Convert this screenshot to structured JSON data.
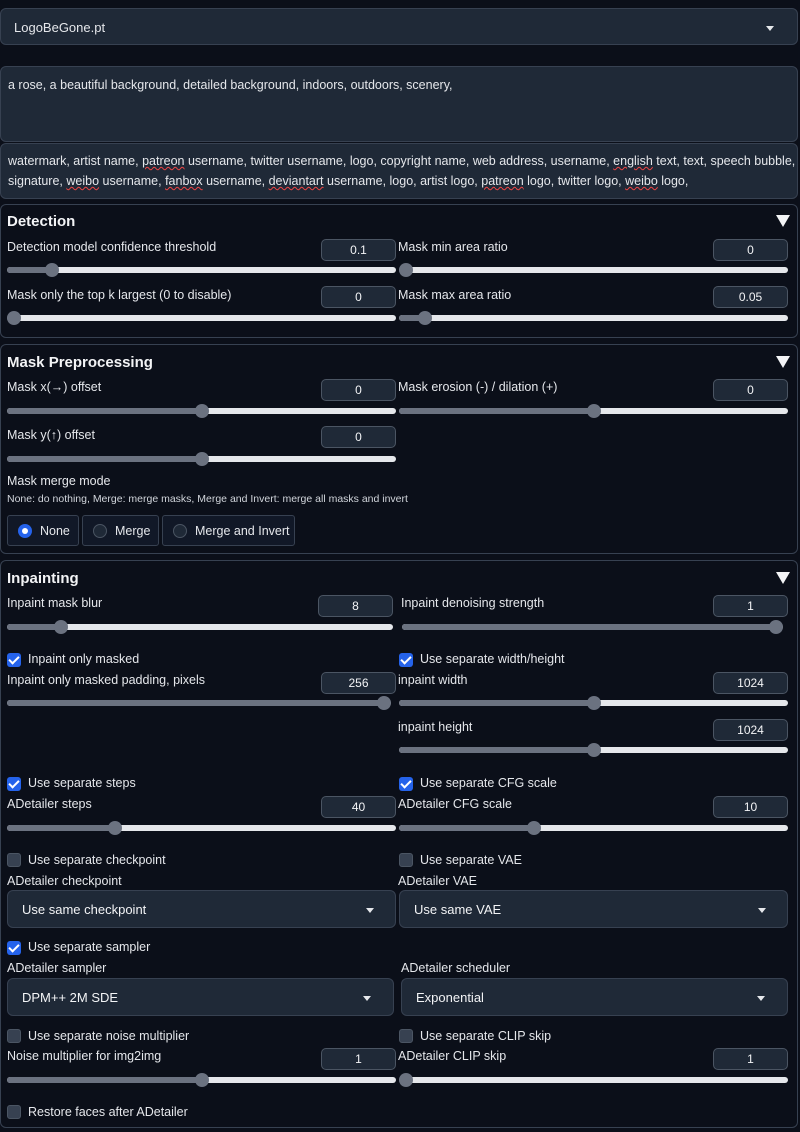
{
  "model_select": {
    "value": "LogoBeGone.pt"
  },
  "prompt": {
    "text": "a rose, a beautiful background, detailed background, indoors, outdoors, scenery,"
  },
  "negative_prompt": {
    "line1": [
      "watermark, artist name, ",
      "patreon",
      " username, twitter username, logo, copyright name, web address, username, ",
      "english",
      " text, text, speech bubble,"
    ],
    "line2": [
      "signature, ",
      "weibo",
      " username, ",
      "fanbox",
      " username, ",
      "deviantart",
      " username, logo, artist logo, ",
      "patreon",
      " logo, twitter logo, ",
      "weibo",
      " logo,"
    ]
  },
  "detection": {
    "title": "Detection",
    "confidence": {
      "label": "Detection model confidence threshold",
      "value": "0.1",
      "fraction": 0.1
    },
    "min_area": {
      "label": "Mask min area ratio",
      "value": "0",
      "fraction": 0
    },
    "top_k": {
      "label": "Mask only the top k largest (0 to disable)",
      "value": "0",
      "fraction": 0
    },
    "max_area": {
      "label": "Mask max area ratio",
      "value": "0.05",
      "fraction": 0.05
    }
  },
  "preprocessing": {
    "title": "Mask Preprocessing",
    "x_offset": {
      "label": "Mask x(→) offset",
      "value": "0",
      "fraction": 0.5
    },
    "erosion": {
      "label": "Mask erosion (-) / dilation (+)",
      "value": "0",
      "fraction": 0.5
    },
    "y_offset": {
      "label": "Mask y(↑) offset",
      "value": "0",
      "fraction": 0.5
    },
    "merge_mode": {
      "label": "Mask merge mode",
      "description": "None: do nothing, Merge: merge masks, Merge and Invert: merge all masks and invert",
      "options": [
        "None",
        "Merge",
        "Merge and Invert"
      ],
      "selected": "None"
    }
  },
  "inpainting": {
    "title": "Inpainting",
    "mask_blur": {
      "label": "Inpaint mask blur",
      "value": "8",
      "fraction": 0.125
    },
    "denoising": {
      "label": "Inpaint denoising strength",
      "value": "1",
      "fraction": 1.0
    },
    "only_masked": {
      "label": "Inpaint only masked",
      "checked": true
    },
    "separate_wh": {
      "label": "Use separate width/height",
      "checked": true
    },
    "padding": {
      "label": "Inpaint only masked padding, pixels",
      "value": "256",
      "fraction": 1.0
    },
    "width": {
      "label": "inpaint width",
      "value": "1024",
      "fraction": 0.5
    },
    "height": {
      "label": "inpaint height",
      "value": "1024",
      "fraction": 0.5
    },
    "separate_steps": {
      "label": "Use separate steps",
      "checked": true
    },
    "separate_cfg": {
      "label": "Use separate CFG scale",
      "checked": true
    },
    "steps": {
      "label": "ADetailer steps",
      "value": "40",
      "fraction": 0.27
    },
    "cfg": {
      "label": "ADetailer CFG scale",
      "value": "10",
      "fraction": 0.34
    },
    "separate_checkpoint": {
      "label": "Use separate checkpoint",
      "checked": false
    },
    "separate_vae": {
      "label": "Use separate VAE",
      "checked": false
    },
    "checkpoint": {
      "label": "ADetailer checkpoint",
      "value": "Use same checkpoint"
    },
    "vae": {
      "label": "ADetailer VAE",
      "value": "Use same VAE"
    },
    "separate_sampler": {
      "label": "Use separate sampler",
      "checked": true
    },
    "sampler": {
      "label": "ADetailer sampler",
      "value": "DPM++ 2M SDE"
    },
    "scheduler": {
      "label": "ADetailer scheduler",
      "value": "Exponential"
    },
    "separate_noise": {
      "label": "Use separate noise multiplier",
      "checked": false
    },
    "separate_clip": {
      "label": "Use separate CLIP skip",
      "checked": false
    },
    "noise": {
      "label": "Noise multiplier for img2img",
      "value": "1",
      "fraction": 0.5
    },
    "clip_skip": {
      "label": "ADetailer CLIP skip",
      "value": "1",
      "fraction": 0.0
    },
    "restore_faces": {
      "label": "Restore faces after ADetailer",
      "checked": false
    }
  }
}
